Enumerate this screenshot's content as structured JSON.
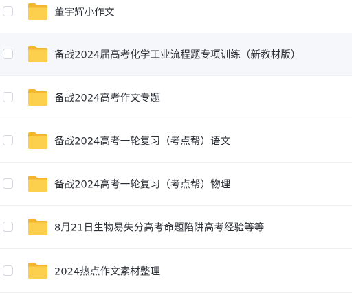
{
  "file_list": {
    "folders": [
      {
        "name": "董宇辉小作文"
      },
      {
        "name": "备战2024届高考化学工业流程题专项训练（新教材版）"
      },
      {
        "name": "备战2024高考作文专题"
      },
      {
        "name": "备战2024高考一轮复习（考点帮）语文"
      },
      {
        "name": "备战2024高考一轮复习（考点帮）物理"
      },
      {
        "name": "8月21日生物易失分高考命题陷阱高考经验等等"
      },
      {
        "name": "2024热点作文素材整理"
      }
    ]
  },
  "colors": {
    "folder_back": "#f5b62f",
    "folder_front": "#fcd04d",
    "row_hover_background": "#f6f7fb",
    "divider": "#eef0f4"
  },
  "icons": {
    "row_icon": "folder-icon",
    "row_select": "checkbox"
  }
}
